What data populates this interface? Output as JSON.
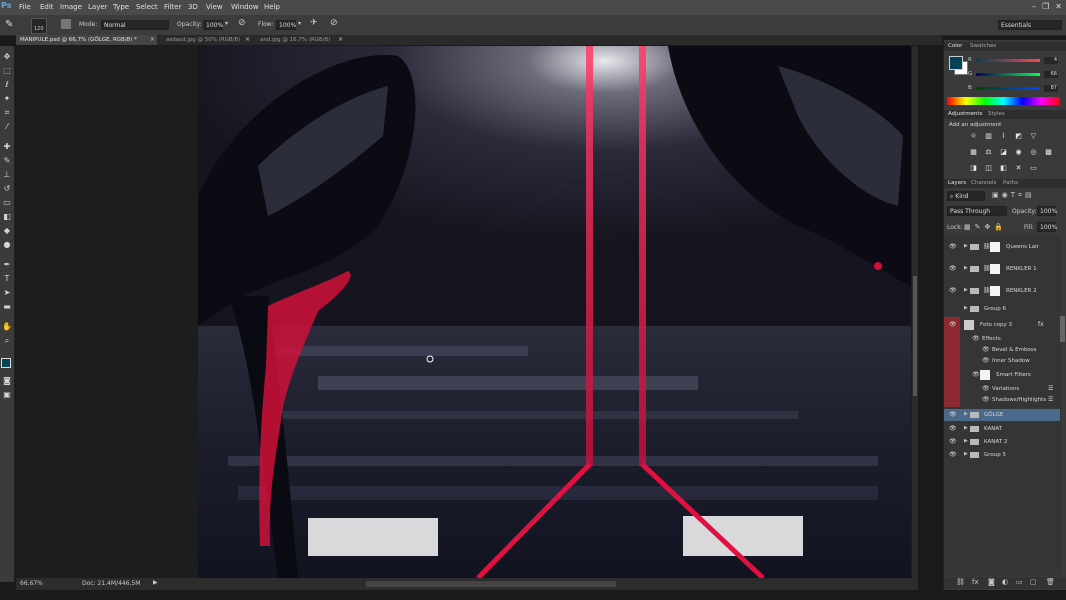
{
  "app": {
    "logo": "Ps"
  },
  "menu": [
    "File",
    "Edit",
    "Image",
    "Layer",
    "Type",
    "Select",
    "Filter",
    "3D",
    "View",
    "Window",
    "Help"
  ],
  "window_controls": [
    "–",
    "❐",
    "✕"
  ],
  "options": {
    "mode_label": "Mode:",
    "mode_value": "Normal",
    "opacity_label": "Opacity:",
    "opacity_value": "100%",
    "flow_label": "Flow:",
    "flow_value": "100%",
    "brush_size": "120",
    "workspace": "Essentials"
  },
  "tabs": [
    {
      "label": "MANIPULE.psd @ 66,7% (GÖLGE, RGB/8) *",
      "active": true
    },
    {
      "label": "asdasd.jpg @ 50% (RGB/8)",
      "active": false
    },
    {
      "label": "and.jpg @ 16,7% (RGB/8)",
      "active": false
    }
  ],
  "status": {
    "zoom": "66,67%",
    "doc": "Doc: 21,4M/446,5M"
  },
  "color_panel": {
    "tabs": [
      "Color",
      "Swatches"
    ],
    "r_label": "R",
    "g_label": "G",
    "b_label": "B",
    "r_value": "4",
    "g_value": "68",
    "b_value": "87",
    "fg_color": "#044457",
    "bg_color": "#ffffff"
  },
  "adjustments_panel": {
    "tabs": [
      "Adjustments",
      "Styles"
    ],
    "title": "Add an adjustment"
  },
  "layers_panel": {
    "tabs": [
      "Layers",
      "Channels",
      "Paths"
    ],
    "kind_label": "Kind",
    "blend_mode": "Pass Through",
    "opacity_label": "Opacity:",
    "opacity_value": "100%",
    "lock_label": "Lock:",
    "fill_label": "Fill:",
    "fill_value": "100%",
    "layers": [
      {
        "name": "Queens Lair",
        "type": "group-mask"
      },
      {
        "name": "RENKLER 1",
        "type": "group-mask"
      },
      {
        "name": "RENKLER 2",
        "type": "group-mask"
      },
      {
        "name": "Group 6",
        "type": "group"
      },
      {
        "name": "Foto copy 3",
        "type": "smart"
      },
      {
        "name": "Effects",
        "type": "sub"
      },
      {
        "name": "Bevel & Emboss",
        "type": "sub2"
      },
      {
        "name": "Inner Shadow",
        "type": "sub2"
      },
      {
        "name": "Smart Filters",
        "type": "sub-thumb"
      },
      {
        "name": "Variations",
        "type": "sub2"
      },
      {
        "name": "Shadows/Highlights",
        "type": "sub2"
      },
      {
        "name": "GÖLGE",
        "type": "group-selected"
      },
      {
        "name": "KANAT",
        "type": "group"
      },
      {
        "name": "KANAT 2",
        "type": "group"
      },
      {
        "name": "Group 5",
        "type": "group"
      }
    ]
  },
  "colors": {
    "accent_red": "#e01040",
    "selection": "#4b6a8a",
    "layer_highlight": "#8a2a30"
  }
}
